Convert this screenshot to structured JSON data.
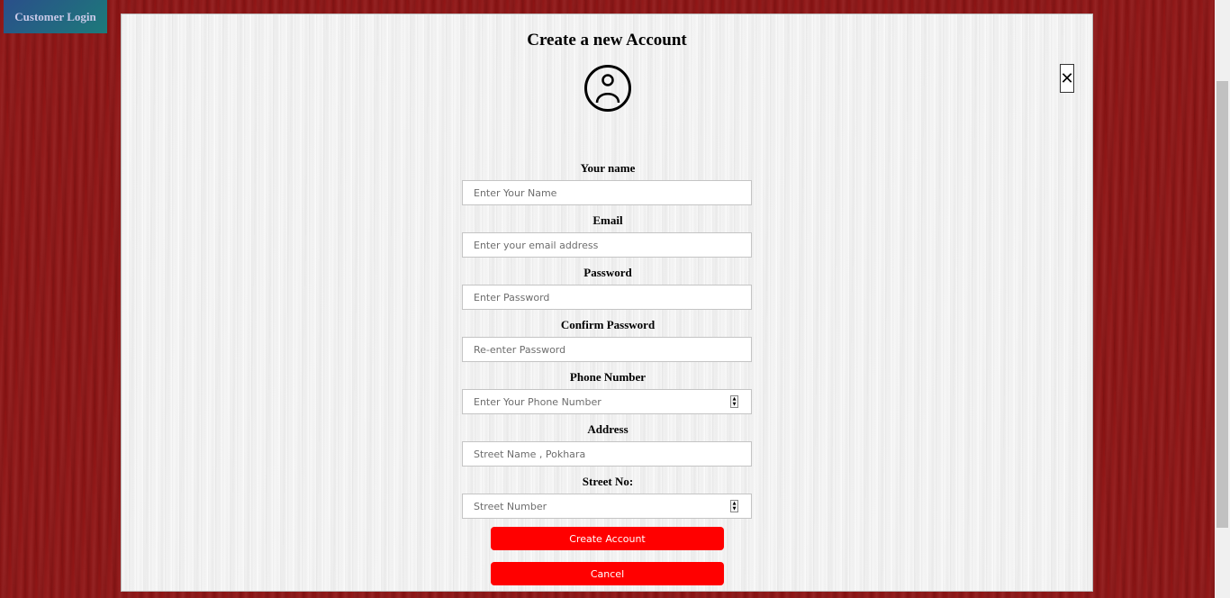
{
  "nav": {
    "customer_login": "Customer Login"
  },
  "modal": {
    "title": "Create a new Account",
    "close_symbol": "✕"
  },
  "form": {
    "fields": [
      {
        "label": "Your name",
        "placeholder": "Enter Your Name",
        "type": "text"
      },
      {
        "label": "Email",
        "placeholder": "Enter your email address",
        "type": "email"
      },
      {
        "label": "Password",
        "placeholder": "Enter Password",
        "type": "password"
      },
      {
        "label": "Confirm Password",
        "placeholder": "Re-enter Password",
        "type": "password"
      },
      {
        "label": "Phone Number",
        "placeholder": "Enter Your Phone Number",
        "type": "number"
      },
      {
        "label": "Address",
        "placeholder": "Street Name , Pokhara",
        "type": "text"
      },
      {
        "label": "Street No:",
        "placeholder": "Street Number",
        "type": "number"
      }
    ],
    "create_label": "Create Account",
    "cancel_label": "Cancel"
  },
  "colors": {
    "page_background": "#8e1414",
    "button": "#ff0000",
    "login_tab": "#2a4f8a"
  },
  "icons": {
    "avatar": "user-circle-icon",
    "close": "close-icon",
    "spinner": "spinner-arrows-icon"
  }
}
